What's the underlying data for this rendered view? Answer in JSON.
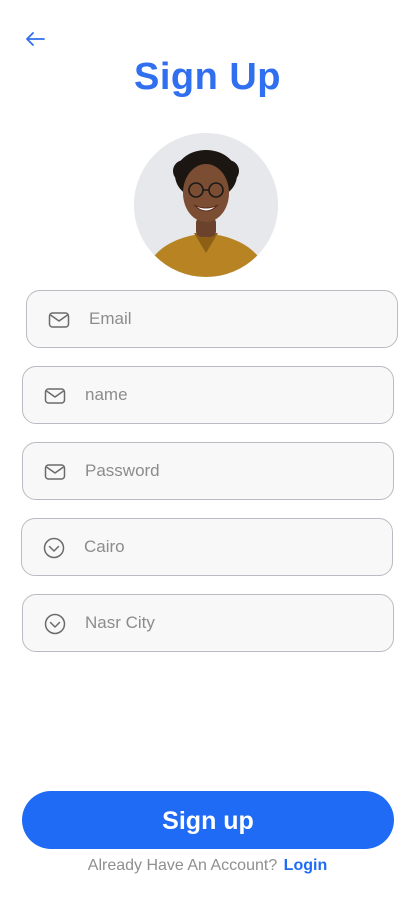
{
  "header": {
    "back_icon": "arrow-left-icon",
    "title": "Sign Up"
  },
  "avatar": {
    "description_icon": "profile-photo"
  },
  "form": {
    "email": {
      "placeholder": "Email",
      "icon": "mail-icon"
    },
    "name": {
      "placeholder": "name",
      "icon": "mail-icon"
    },
    "password": {
      "placeholder": "Password",
      "icon": "mail-icon"
    },
    "city": {
      "value": "Cairo",
      "icon": "chevron-down-circle-icon"
    },
    "district": {
      "value": "Nasr City",
      "icon": "chevron-down-circle-icon"
    }
  },
  "actions": {
    "signup_label": "Sign up",
    "account_prompt": "Already Have An Account?",
    "login_label": "Login"
  },
  "colors": {
    "primary": "#1f6bf5",
    "title": "#2f6ff0",
    "field_border": "#b9bcc2",
    "placeholder": "#8c8c8c"
  }
}
